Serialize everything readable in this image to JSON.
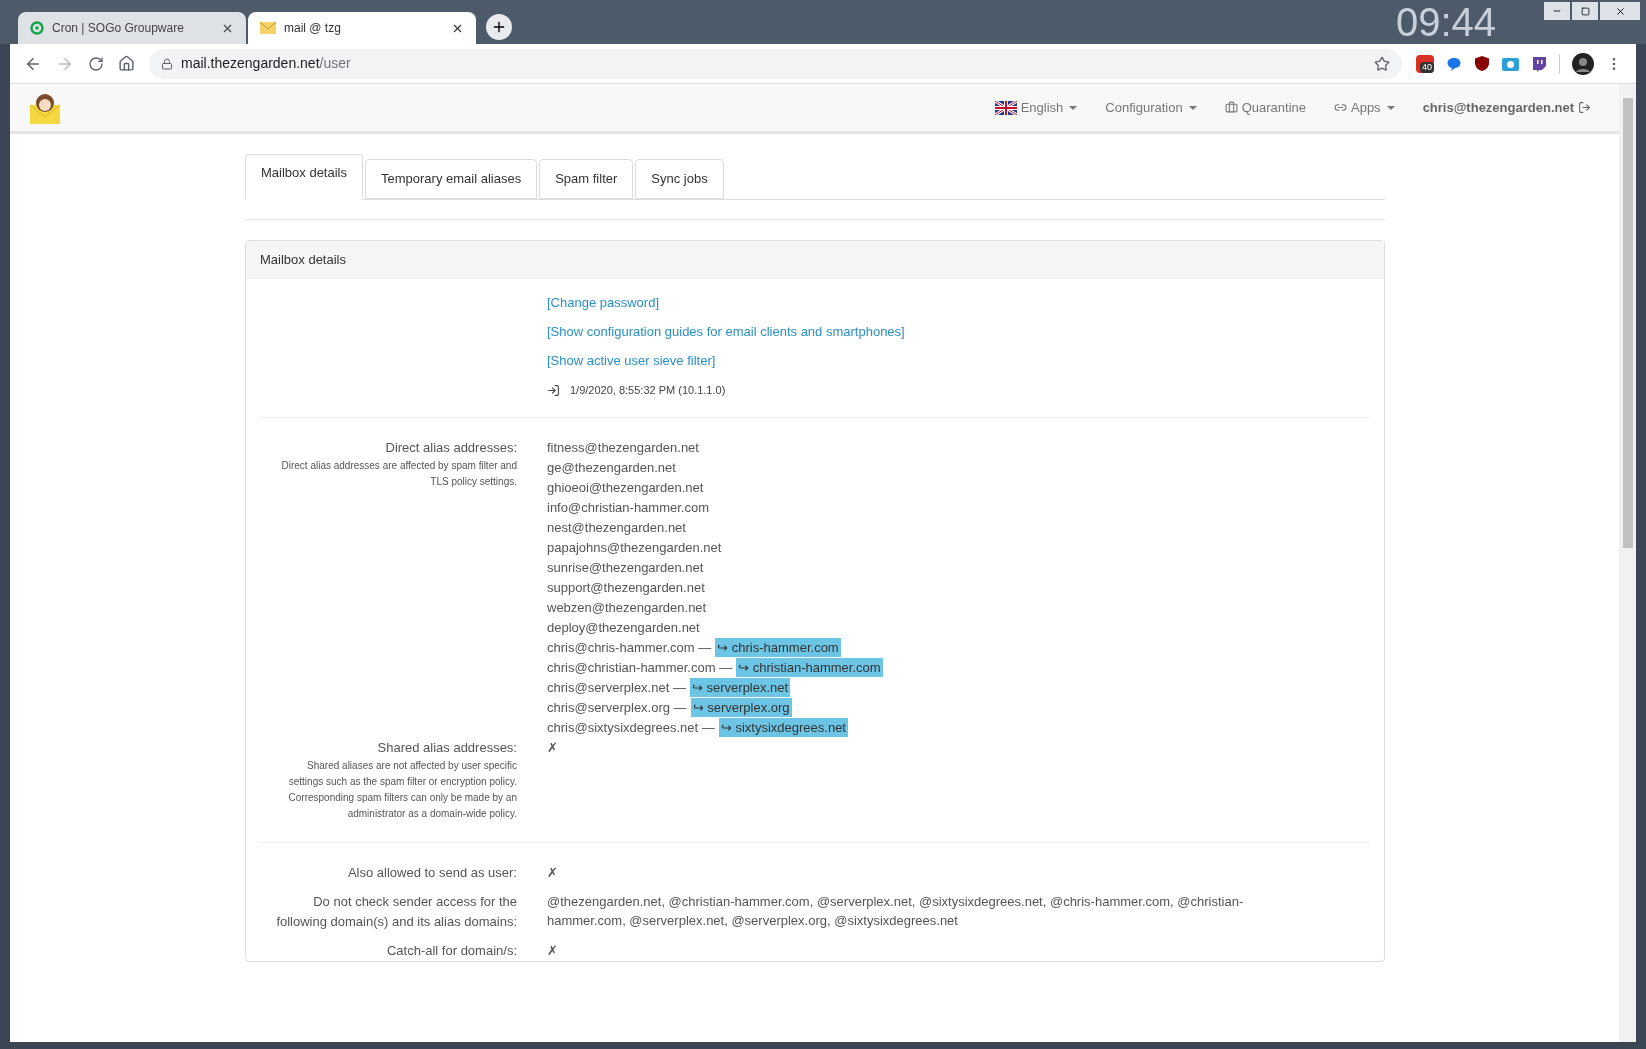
{
  "browser": {
    "tabs": [
      {
        "title": "Cron | SOGo Groupware",
        "selected": false,
        "kind": "ring"
      },
      {
        "title": "mail @ tzg",
        "selected": true,
        "kind": "envelope"
      }
    ],
    "desktop_clock": "09:44",
    "url_host": "mail.thezengarden.net",
    "url_path": "/user",
    "extension_badge": "40"
  },
  "navbar": {
    "items": [
      {
        "label": "English",
        "kind": "flag"
      },
      {
        "label": "Configuration",
        "kind": "plain"
      },
      {
        "label": "Quarantine",
        "kind": "briefcase"
      },
      {
        "label": "Apps",
        "kind": "link"
      }
    ],
    "user": "chris@thezengarden.net"
  },
  "tabs": [
    {
      "label": "Mailbox details",
      "selected": true
    },
    {
      "label": "Temporary email aliases",
      "selected": false
    },
    {
      "label": "Spam filter",
      "selected": false
    },
    {
      "label": "Sync jobs",
      "selected": false
    }
  ],
  "panel": {
    "title": "Mailbox details",
    "links": [
      "[Change password]",
      "[Show configuration guides for email clients and smartphones]",
      "[Show active user sieve filter]"
    ],
    "last_login": "1/9/2020, 8:55:32 PM (10.1.1.0)",
    "direct_aliases": {
      "label": "Direct alias addresses:",
      "help": "Direct alias addresses are affected by spam filter and TLS policy settings.",
      "addresses": [
        {
          "address": "fitness@thezengarden.net"
        },
        {
          "address": "ge@thezengarden.net"
        },
        {
          "address": "ghioeoi@thezengarden.net"
        },
        {
          "address": "info@christian-hammer.com"
        },
        {
          "address": "nest@thezengarden.net"
        },
        {
          "address": "papajohns@thezengarden.net"
        },
        {
          "address": "sunrise@thezengarden.net"
        },
        {
          "address": "support@thezengarden.net"
        },
        {
          "address": "webzen@thezengarden.net"
        },
        {
          "address": "deploy@thezengarden.net"
        },
        {
          "address": "chris@chris-hammer.com —",
          "domain": "↪ chris-hammer.com"
        },
        {
          "address": "chris@christian-hammer.com —",
          "domain": "↪ christian-hammer.com"
        },
        {
          "address": "chris@serverplex.net —",
          "domain": "↪ serverplex.net"
        },
        {
          "address": "chris@serverplex.org —",
          "domain": "↪ serverplex.org"
        },
        {
          "address": "chris@sixtysixdegrees.net —",
          "domain": "↪ sixtysixdegrees.net"
        }
      ]
    },
    "shared_aliases": {
      "label": "Shared alias addresses:",
      "help": "Shared aliases are not affected by user specific settings such as the spam filter or encryption policy. Corresponding spam filters can only be made by an administrator as a domain-wide policy.",
      "value": "✗"
    },
    "settings": [
      {
        "label": "Also allowed to send as user:",
        "value": "✗"
      },
      {
        "label": "Do not check sender access for the following domain(s) and its alias domains:",
        "value": "@thezengarden.net, @christian-hammer.com, @serverplex.net, @sixtysixdegrees.net, @chris-hammer.com, @christian-hammer.com, @serverplex.net, @serverplex.org, @sixtysixdegrees.net"
      },
      {
        "label": "Catch-all for domain/s:",
        "value": "✗"
      }
    ]
  }
}
